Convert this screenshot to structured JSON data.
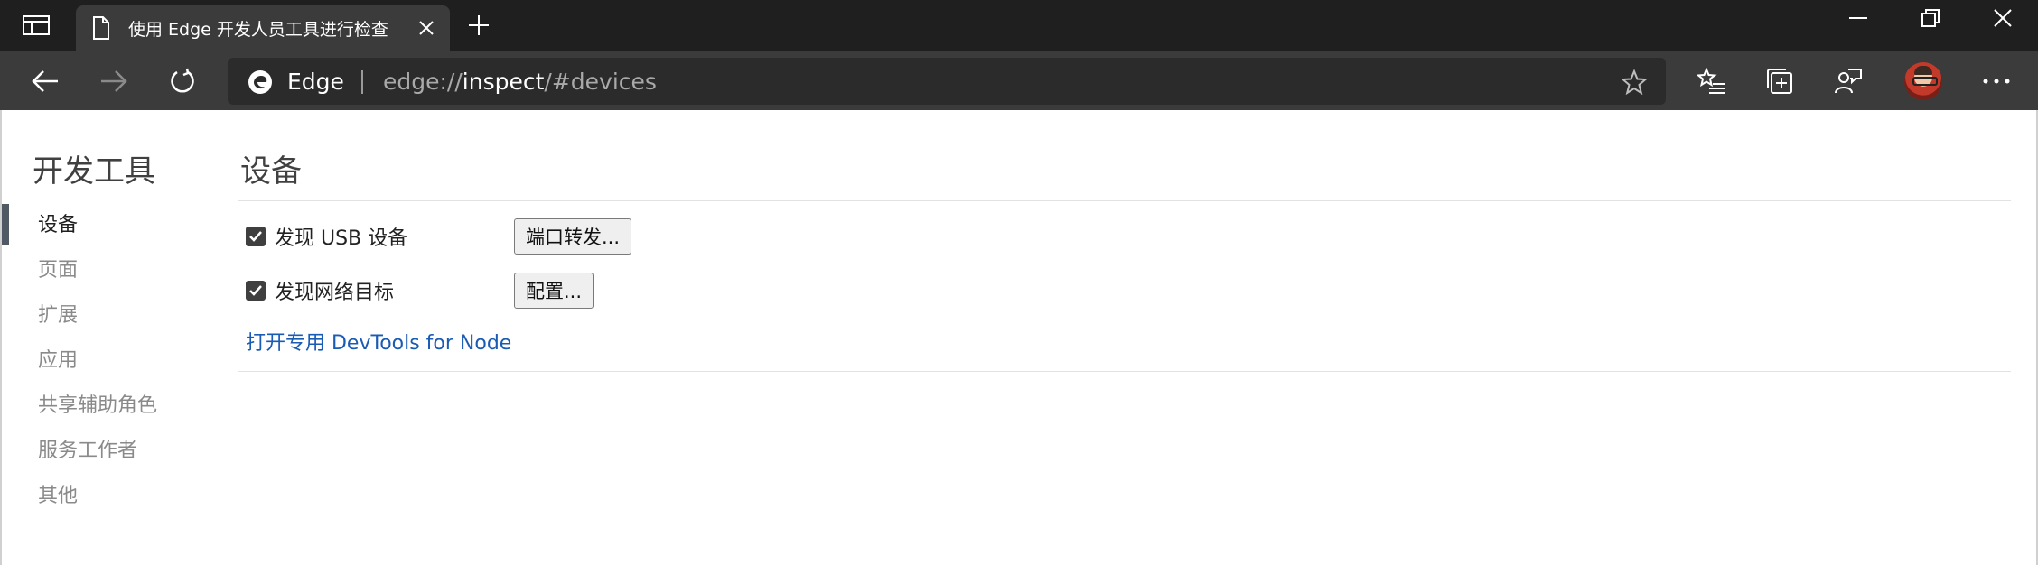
{
  "tab": {
    "title": "使用 Edge 开发人员工具进行检查"
  },
  "omnibox": {
    "label": "Edge",
    "url_scheme": "edge://",
    "url_host": "inspect",
    "url_rest": "/#devices"
  },
  "sidebar": {
    "title": "开发工具",
    "items": [
      {
        "label": "设备"
      },
      {
        "label": "页面"
      },
      {
        "label": "扩展"
      },
      {
        "label": "应用"
      },
      {
        "label": "共享辅助角色"
      },
      {
        "label": "服务工作者"
      },
      {
        "label": "其他"
      }
    ]
  },
  "main": {
    "title": "设备",
    "discover_usb": {
      "label": "发现 USB 设备",
      "checked": true,
      "button": "端口转发..."
    },
    "discover_network": {
      "label": "发现网络目标",
      "checked": true,
      "button": "配置..."
    },
    "node_link": "打开专用 DevTools for Node"
  }
}
